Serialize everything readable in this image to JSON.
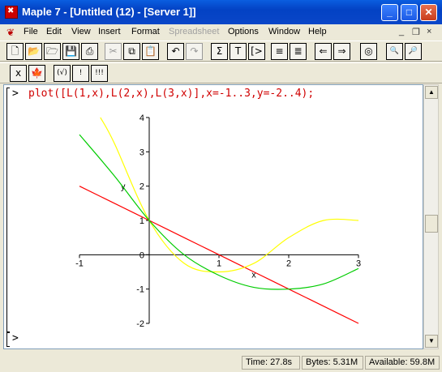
{
  "window": {
    "title": "Maple 7  - [Untitled (12) - [Server 1]]",
    "minimize": "_",
    "maximize": "□",
    "close": "✕"
  },
  "menu": [
    "File",
    "Edit",
    "View",
    "Insert",
    "Format",
    "Spreadsheet",
    "Options",
    "Window",
    "Help"
  ],
  "menu_disabled": [
    "Spreadsheet"
  ],
  "mdi_controls": {
    "minimize": "_",
    "restore": "❐",
    "close": "×"
  },
  "toolbar1": [
    {
      "name": "new-icon",
      "glyph": "🗋"
    },
    {
      "name": "open-icon",
      "glyph": "📂"
    },
    {
      "name": "open-url-icon",
      "glyph": "🗁"
    },
    {
      "name": "save-icon",
      "glyph": "💾"
    },
    {
      "name": "print-icon",
      "glyph": "⎙"
    },
    {
      "name": "cut-icon",
      "glyph": "✂"
    },
    {
      "name": "copy-icon",
      "glyph": "⧉"
    },
    {
      "name": "paste-icon",
      "glyph": "📋"
    },
    {
      "name": "undo-icon",
      "glyph": "↶"
    },
    {
      "name": "redo-icon",
      "glyph": "↷"
    },
    {
      "name": "sigma-icon",
      "glyph": "Σ"
    },
    {
      "name": "text-icon",
      "glyph": "T"
    },
    {
      "name": "input-icon",
      "glyph": "[>"
    },
    {
      "name": "indent-icon",
      "glyph": "≡"
    },
    {
      "name": "outdent-icon",
      "glyph": "≣"
    },
    {
      "name": "back-icon",
      "glyph": "⇐"
    },
    {
      "name": "forward-icon",
      "glyph": "⇒"
    },
    {
      "name": "stop-icon",
      "glyph": "◎"
    },
    {
      "name": "zoom-in-icon",
      "glyph": "🔍"
    },
    {
      "name": "zoom-out-icon",
      "glyph": "🔎"
    }
  ],
  "toolbar2": [
    {
      "name": "maple-x-icon",
      "glyph": "x"
    },
    {
      "name": "maple-leaf-icon",
      "glyph": "🍁"
    },
    {
      "name": "check-icon",
      "glyph": "(√)"
    },
    {
      "name": "exclaim-icon",
      "glyph": "!"
    },
    {
      "name": "triple-exclaim-icon",
      "glyph": "!!!"
    }
  ],
  "document": {
    "prompt": ">",
    "command": "plot([L(1,x),L(2,x),L(3,x)],x=-1..3,y=-2..4);",
    "empty_prompt": ">"
  },
  "chart_data": {
    "type": "line",
    "xlabel": "x",
    "ylabel": "y",
    "xlim": [
      -1,
      3
    ],
    "ylim": [
      -2,
      4
    ],
    "xticks": [
      "-1",
      "0",
      "1",
      "2",
      "3"
    ],
    "xtick_values": [
      -1,
      0,
      1,
      2,
      3
    ],
    "yticks": [
      "-2",
      "-1",
      "0",
      "1",
      "2",
      "3",
      "4"
    ],
    "ytick_values": [
      -2,
      -1,
      0,
      1,
      2,
      3,
      4
    ],
    "series": [
      {
        "color": "#ff0000",
        "x": [
          -1,
          -0.5,
          0,
          0.5,
          1,
          1.5,
          2,
          2.5,
          3
        ],
        "y": [
          2,
          1.5,
          1,
          0.5,
          0,
          -0.5,
          -1,
          -1.5,
          -2
        ]
      },
      {
        "color": "#ffff00",
        "x": [
          -0.7,
          -0.5,
          0,
          0.5,
          1,
          1.5,
          2,
          2.5,
          3
        ],
        "y": [
          4.0,
          3.25,
          1,
          -0.25,
          -0.5,
          -0.25,
          0.5,
          1.0,
          1.0
        ]
      },
      {
        "color": "#00cc00",
        "x": [
          -1,
          -0.5,
          0,
          0.5,
          1,
          1.5,
          2,
          2.5,
          3
        ],
        "y": [
          3.5,
          2.3,
          1,
          0.0,
          -0.6,
          -0.95,
          -1,
          -0.85,
          -0.4
        ]
      }
    ]
  },
  "status": {
    "time": "Time:  27.8s",
    "bytes": "Bytes: 5.31M",
    "available": "Available: 59.8M"
  }
}
